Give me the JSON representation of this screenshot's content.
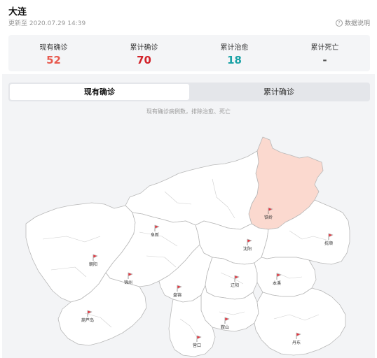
{
  "header": {
    "title": "大连",
    "update_time": "更新至 2020.07.29 14:39",
    "data_note": "数据说明"
  },
  "stats": [
    {
      "label": "现有确诊",
      "value": "52",
      "color": "#e85a4f"
    },
    {
      "label": "累计确诊",
      "value": "70",
      "color": "#d2232a"
    },
    {
      "label": "累计治愈",
      "value": "18",
      "color": "#1aa2a6"
    },
    {
      "label": "累计死亡",
      "value": "-",
      "color": "#555555"
    }
  ],
  "tabs": [
    {
      "label": "现有确诊",
      "active": true
    },
    {
      "label": "累计确诊",
      "active": false
    }
  ],
  "map": {
    "caption": "现有确诊病例数，排除治愈、死亡",
    "highlight_color": "#fbd9cf",
    "region_color": "#ffffff",
    "flag_color": "#e8323c",
    "cities": [
      {
        "name": "铁岭",
        "highlighted": true
      },
      {
        "name": "阜新",
        "highlighted": false
      },
      {
        "name": "沈阳",
        "highlighted": false
      },
      {
        "name": "抚顺",
        "highlighted": false
      },
      {
        "name": "朝阳",
        "highlighted": false
      },
      {
        "name": "锦州",
        "highlighted": false
      },
      {
        "name": "盘锦",
        "highlighted": false
      },
      {
        "name": "辽阳",
        "highlighted": false
      },
      {
        "name": "本溪",
        "highlighted": false
      },
      {
        "name": "葫芦岛",
        "highlighted": false
      },
      {
        "name": "鞍山",
        "highlighted": false
      },
      {
        "name": "丹东",
        "highlighted": false
      },
      {
        "name": "营口",
        "highlighted": false
      }
    ]
  }
}
